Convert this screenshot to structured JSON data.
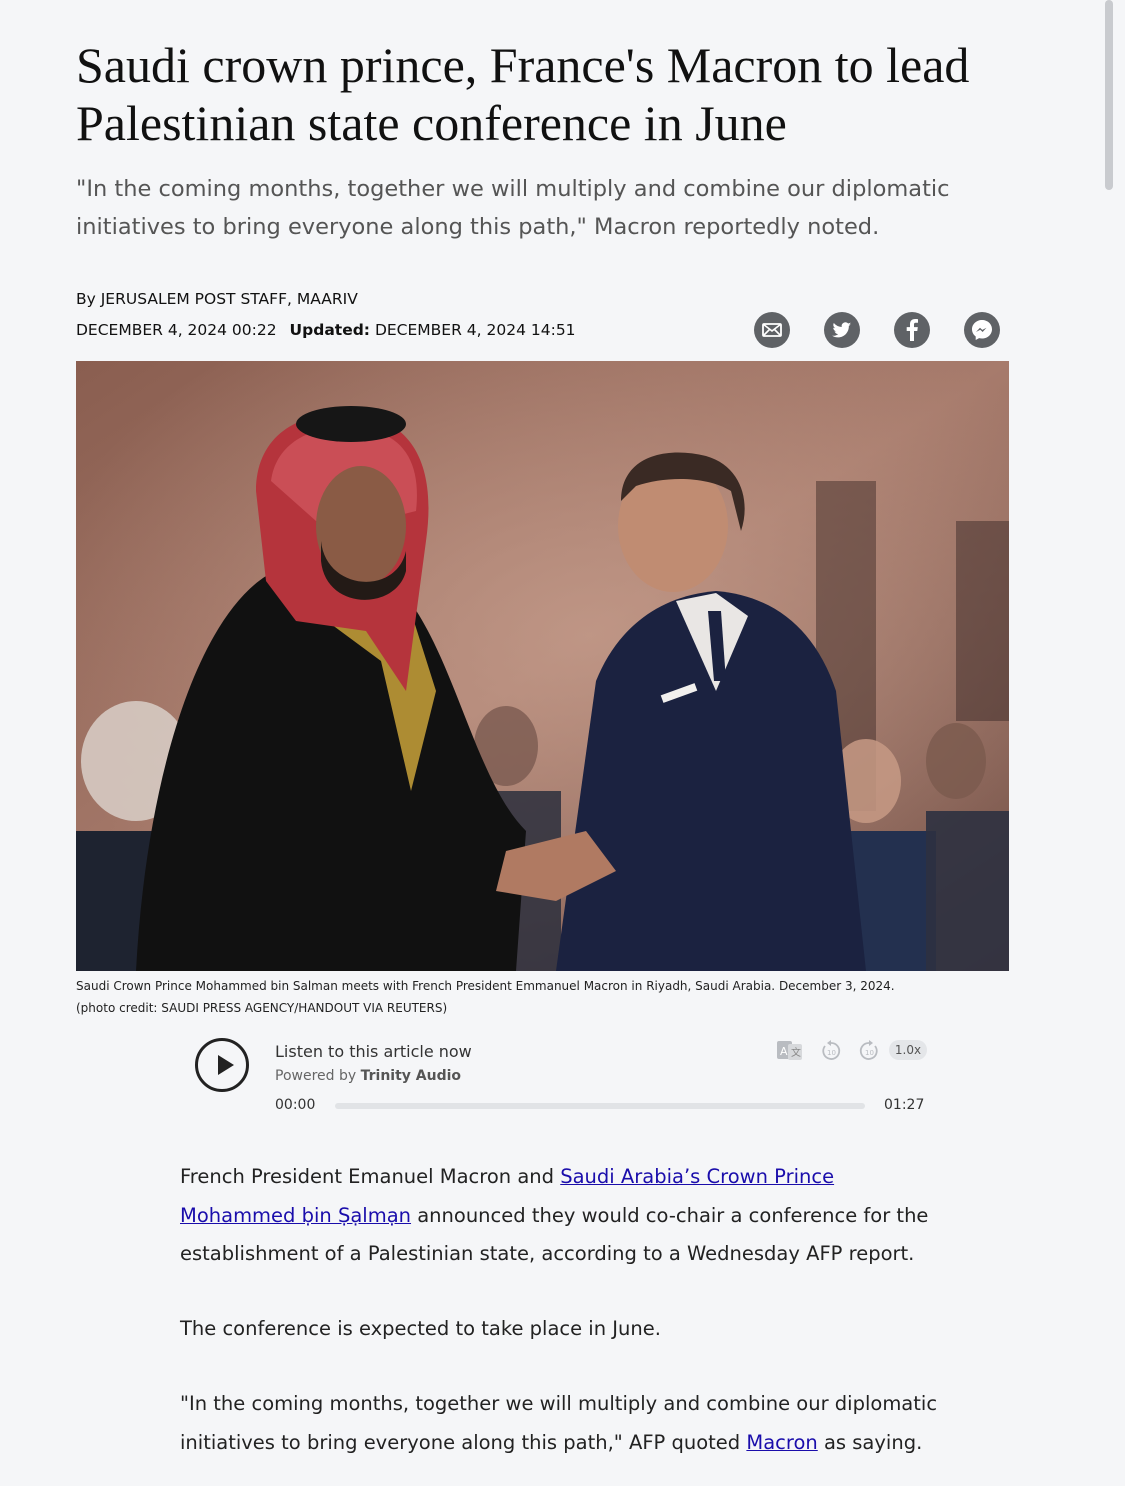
{
  "article": {
    "headline": "Saudi crown prince, France's Macron to lead Palestinian state conference in June",
    "subtitle": "\"In the coming months, together we will multiply and combine our diplomatic initiatives to bring everyone along this path,\" Macron reportedly noted.",
    "byline": "By JERUSALEM POST STAFF, MAARIV",
    "published": "DECEMBER 4, 2024 00:22",
    "updated_label": "Updated:",
    "updated": "DECEMBER 4, 2024 14:51"
  },
  "share": {
    "icons": [
      "email-icon",
      "twitter-icon",
      "facebook-icon",
      "messenger-icon"
    ],
    "icon_color": "#5f6266"
  },
  "photo": {
    "caption": "Saudi Crown Prince Mohammed bin Salman meets with French President Emmanuel Macron in Riyadh, Saudi Arabia. December 3, 2024.",
    "credit": "(photo credit: SAUDI PRESS AGENCY/HANDOUT VIA REUTERS)"
  },
  "player": {
    "title": "Listen to this article now",
    "powered_prefix": "Powered by",
    "powered_brand": "Trinity Audio",
    "current_time": "00:00",
    "duration": "01:27",
    "speed": "1.0x",
    "progress": 0
  },
  "body": {
    "p1_pre": "French President Emanuel Macron and ",
    "p1_link": "Saudi Arabia’s Crown Prince Mohammed ḅin Ṣạlmạn",
    "p1_post": " announced they would co-chair a conference for the establishment of a Palestinian state, according to a Wednesday AFP report.",
    "p2": "The conference is expected to take place in June.",
    "p3_pre": "\"In the coming months, together we will multiply and combine our diplomatic initiatives to bring everyone along this path,\" AFP quoted ",
    "p3_link": "Macron",
    "p3_post": " as saying."
  },
  "colors": {
    "link": "#1a0dab",
    "background": "#f5f6f8"
  }
}
